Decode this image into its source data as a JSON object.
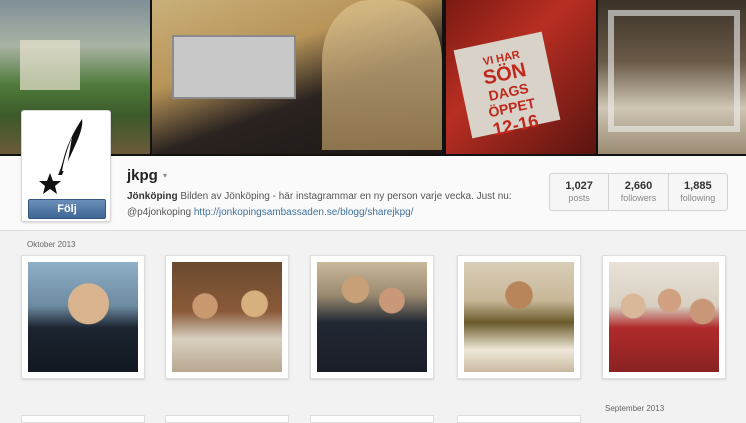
{
  "cover": {
    "sign": {
      "line1": "VI HAR",
      "line2": "SÖN",
      "line3": "DAGS",
      "line4": "ÖPPET",
      "line5": "12-16"
    }
  },
  "profile": {
    "username": "jkpg",
    "menu_icon": "▾",
    "follow_label": "Följ",
    "bio_name": "Jönköping",
    "bio_text": " Bilden av Jönköping - här instagrammar en ny person varje vecka. Just nu: @p4jonkoping ",
    "bio_link": "http://jonkopingsambassaden.se/blogg/sharejkpg/"
  },
  "stats": [
    {
      "value": "1,027",
      "label": "posts"
    },
    {
      "value": "2,660",
      "label": "followers"
    },
    {
      "value": "1,885",
      "label": "following"
    }
  ],
  "months": {
    "current": "Oktober 2013",
    "next": "September 2013"
  },
  "colors": {
    "button": "#3e6695",
    "link": "#3f729b"
  }
}
